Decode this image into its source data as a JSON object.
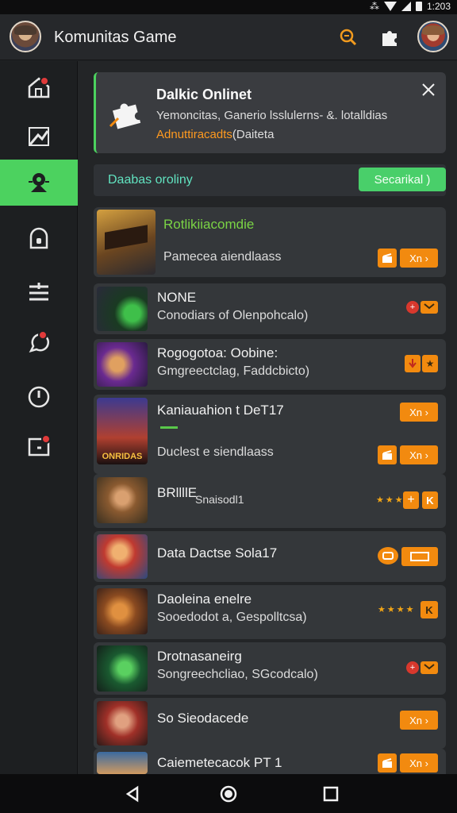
{
  "status_bar": {
    "time": "1:203"
  },
  "header": {
    "title": "Komunitas Game"
  },
  "sidebar": {
    "items": [
      {
        "icon": "home-icon",
        "badge": true
      },
      {
        "icon": "chart-icon",
        "badge": false
      },
      {
        "icon": "community-icon",
        "badge": false,
        "active": true
      },
      {
        "icon": "lock-icon",
        "badge": false
      },
      {
        "icon": "list-icon",
        "badge": false
      },
      {
        "icon": "chat-icon",
        "badge": true
      },
      {
        "icon": "clock-icon",
        "badge": false
      },
      {
        "icon": "inbox-icon",
        "badge": true
      }
    ]
  },
  "notification": {
    "title": "Dalkic Onlinet",
    "line1": "Yemoncitas, Ganerio lsslulerns- &. lotalldias",
    "line2_orange": "Adnuttiracadts",
    "line2_rest": "(Daiteta",
    "close_label": "×"
  },
  "search_row": {
    "label": "Daabas oroliny",
    "button": "Secarikal )"
  },
  "games": [
    {
      "title": "Rotlikiiacomdie",
      "subtitle": "Pamecea aiendlaass",
      "button": "Xn ›"
    },
    {
      "title": "NONE",
      "subtitle": "Conodiars of Olenpohcalo)"
    },
    {
      "title": "Rogogotoa: Oobine:",
      "subtitle": "Gmgreectclag, Faddcbicto)"
    },
    {
      "title": "Kaniauahion t DeT17",
      "subtitle": "Duclest e siendlaass",
      "button_top": "Xn ›",
      "button": "Xn ›",
      "thumb_text": "ONRIDAS"
    },
    {
      "title": "BRllllE",
      "subtitle": "Snaisodl1",
      "rating": "★★★"
    },
    {
      "title": "Data Dactse Sola17"
    },
    {
      "title": "Daoleina enelre",
      "subtitle": "Sooedodot a, Gespolltcsa)",
      "rating": "★★★★"
    },
    {
      "title": "Drotnasaneirg",
      "subtitle": "Songreechcliao, SGcodcalo)"
    },
    {
      "title": "So Sieodacede",
      "button": "Xn ›"
    },
    {
      "title": "Caiemetecacok PT 1",
      "button": "Xn ›"
    }
  ],
  "colors": {
    "accent_green": "#4cd25f",
    "orange": "#f28a0f",
    "background": "#232527"
  }
}
